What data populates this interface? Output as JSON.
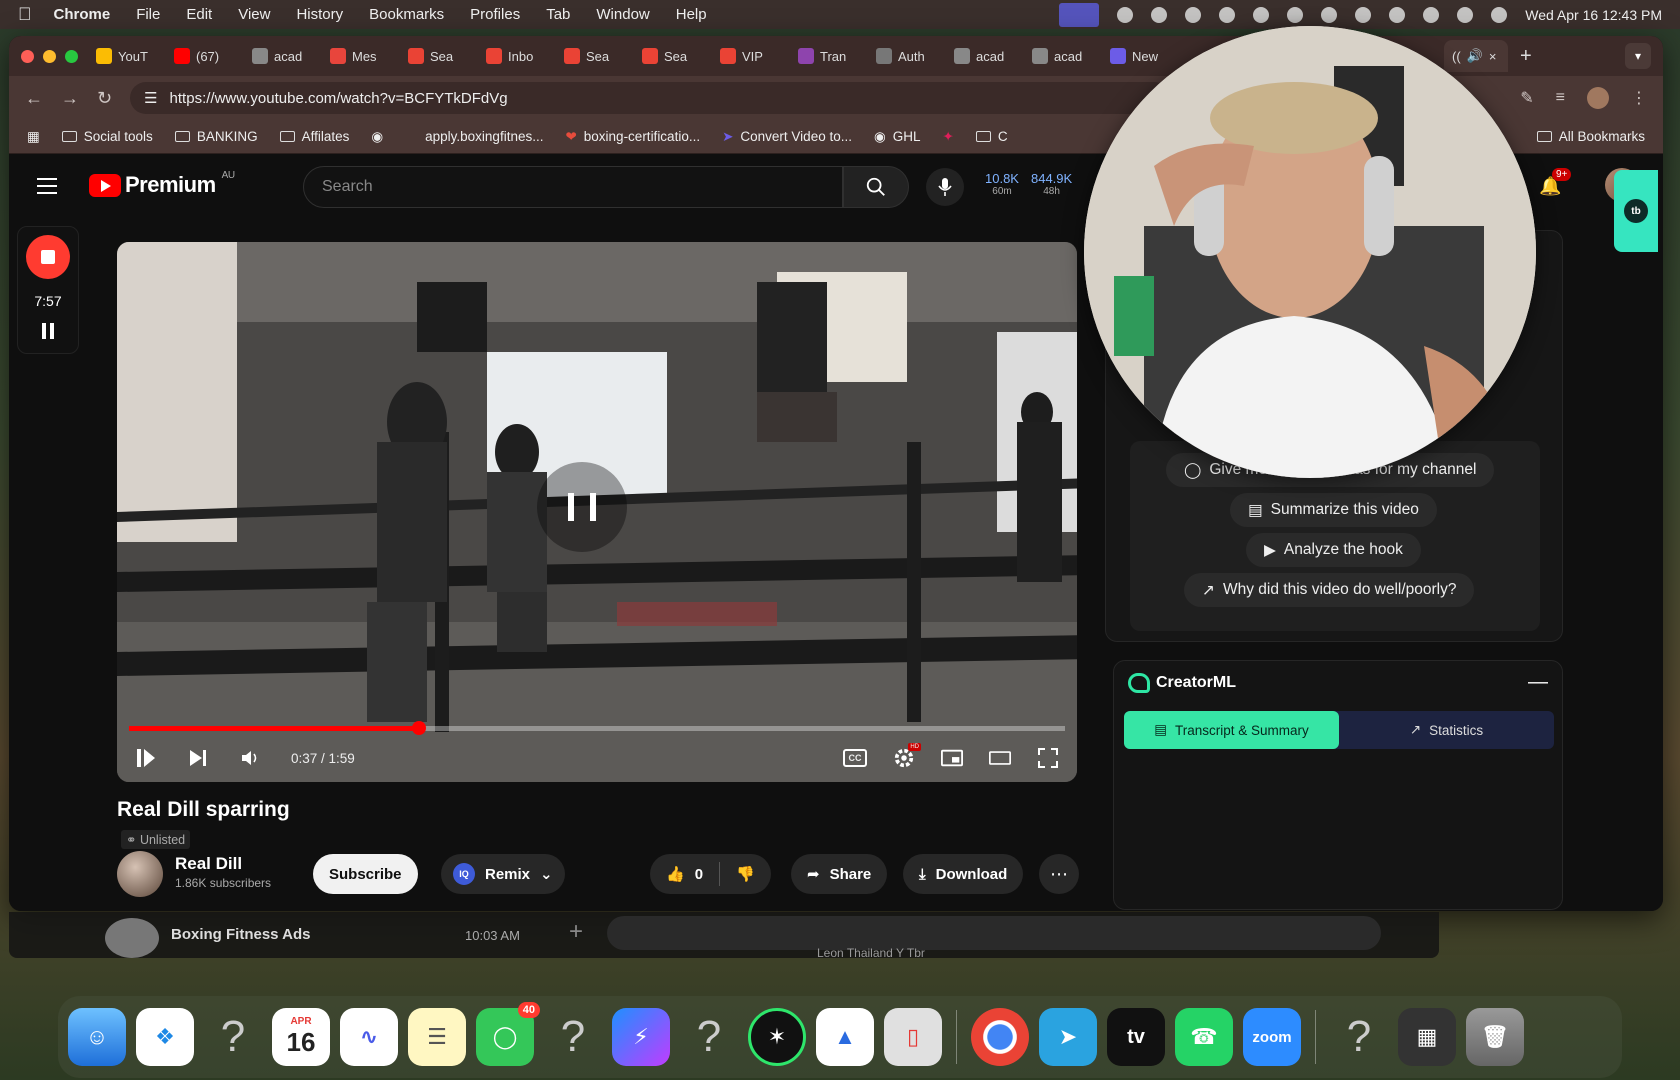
{
  "menubar": {
    "app": "Chrome",
    "items": [
      "File",
      "Edit",
      "View",
      "History",
      "Bookmarks",
      "Profiles",
      "Tab",
      "Window",
      "Help"
    ],
    "clock": "Wed Apr 16  12:43 PM"
  },
  "tabs": [
    {
      "label": "YouT",
      "color": "#fbbc04"
    },
    {
      "label": "(67)",
      "color": "#ff0000"
    },
    {
      "label": "acad",
      "color": "#888888"
    },
    {
      "label": "Mes",
      "color": "#e8453c"
    },
    {
      "label": "Sea",
      "color": "#ea4335"
    },
    {
      "label": "Inbo",
      "color": "#ea4335"
    },
    {
      "label": "Sea",
      "color": "#ea4335"
    },
    {
      "label": "Sea",
      "color": "#ea4335"
    },
    {
      "label": "VIP",
      "color": "#ea4335"
    },
    {
      "label": "Tran",
      "color": "#8e44ad"
    },
    {
      "label": "Auth",
      "color": "#777777"
    },
    {
      "label": "acad",
      "color": "#888888"
    },
    {
      "label": "acad",
      "color": "#888888"
    },
    {
      "label": "New",
      "color": "#6c5ce7"
    }
  ],
  "active_tab": {
    "label": "(("
  },
  "url": "https://www.youtube.com/watch?v=BCFYTkDFdVg",
  "bookmarks": {
    "items": [
      "Social tools",
      "BANKING",
      "Affilates",
      "apply.boxingfitnes...",
      "boxing-certificatio...",
      "Convert Video to...",
      "GHL",
      "C"
    ],
    "all": "All Bookmarks"
  },
  "yt": {
    "brand": "Premium",
    "region": "AU",
    "search_placeholder": "Search",
    "stat1": {
      "value": "10.8K",
      "period": "60m"
    },
    "stat2": {
      "value": "844.9K",
      "period": "48h"
    },
    "notif_count": "9+"
  },
  "recorder": {
    "time": "7:57"
  },
  "player": {
    "time": "0:37 / 1:59",
    "progress": 0.31,
    "cc": "CC"
  },
  "video": {
    "title": "Real Dill sparring",
    "visibility": "Unlisted",
    "channel": "Real Dill",
    "subs": "1.86K subscribers",
    "subscribe": "Subscribe",
    "remix": "Remix",
    "likes": "0",
    "share": "Share",
    "download": "Download"
  },
  "ai": {
    "chips": [
      "Give me 3 similar ideas for my channel",
      "Summarize this video",
      "Analyze the hook",
      "Why did this video do well/poorly?"
    ]
  },
  "creator": {
    "name": "CreatorML",
    "tab1": "Transcript & Summary",
    "tab2": "Statistics"
  },
  "sidetab": {
    "label": "tb"
  },
  "strip": {
    "name": "Boxing Fitness Ads",
    "time": "10:03 AM",
    "faded": "Leon Thailand Y Tbr"
  },
  "dock": {
    "calendar_month": "APR",
    "calendar_day": "16",
    "messages_badge": "40",
    "zoom": "zoom",
    "tv": "tv"
  }
}
